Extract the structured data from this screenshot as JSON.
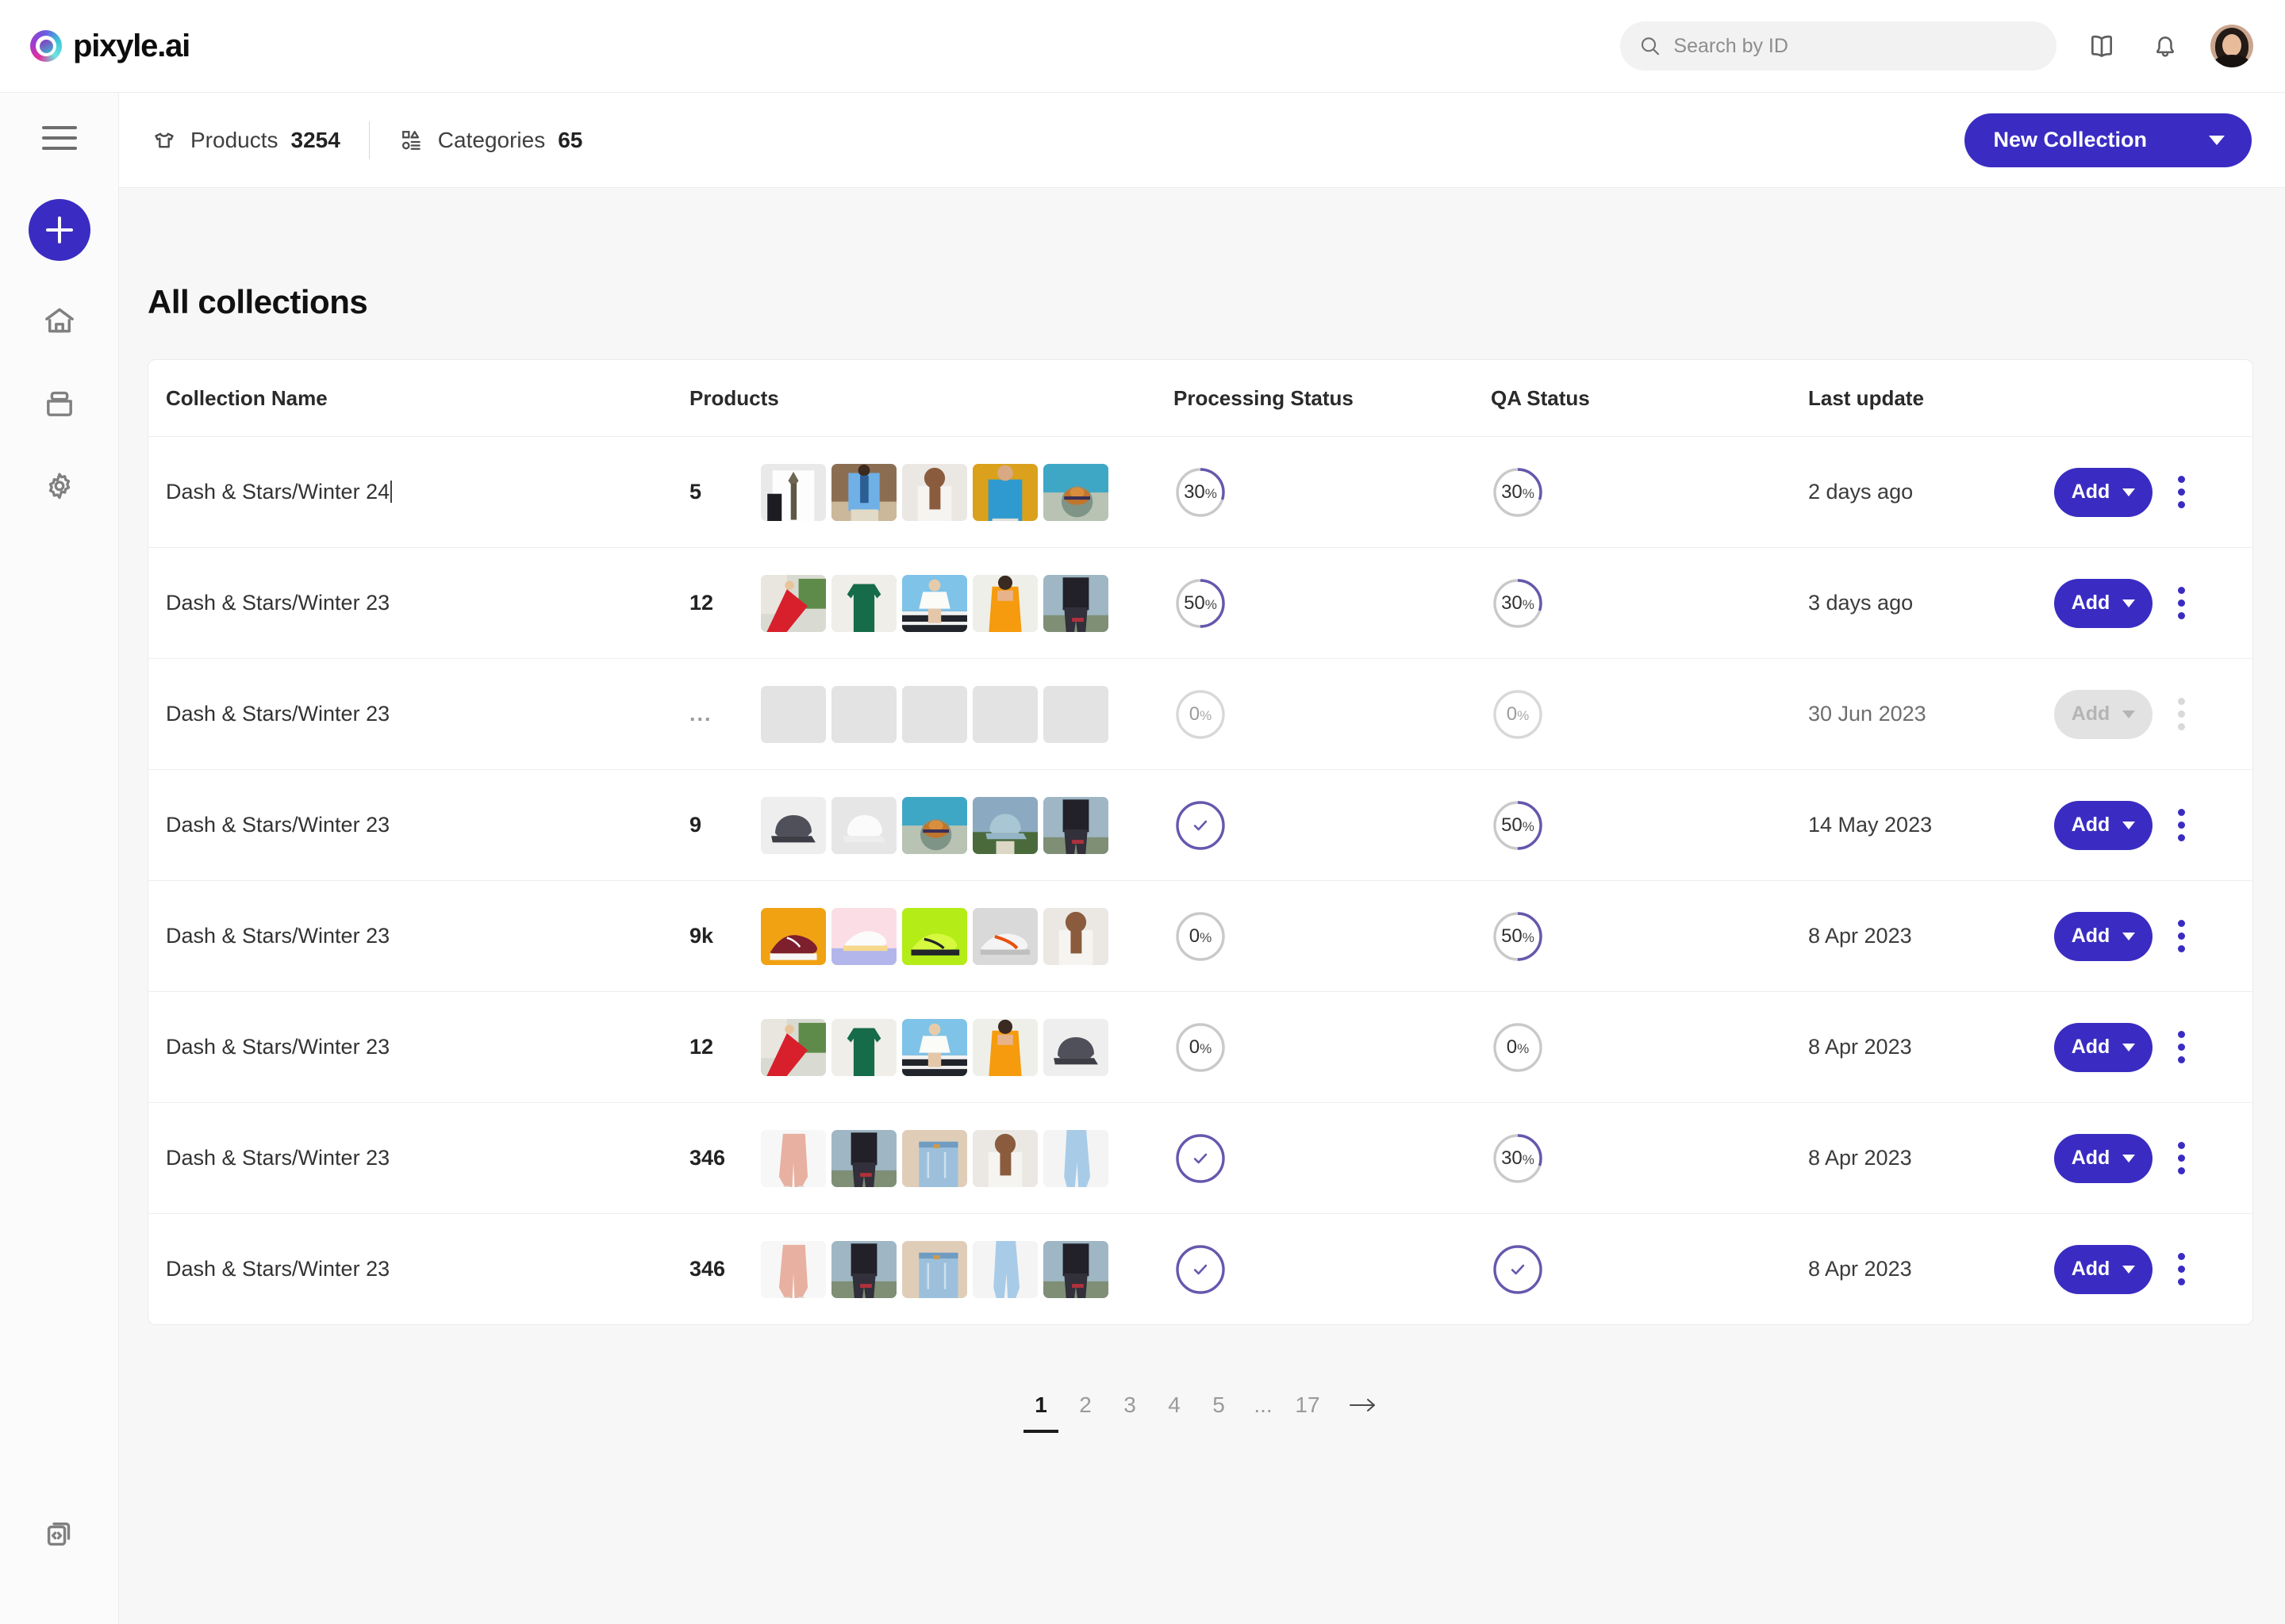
{
  "brand": {
    "name": "pixyle.ai",
    "logo_icon": "pixyle-eye-logo"
  },
  "search": {
    "placeholder": "Search by ID",
    "value": ""
  },
  "topbar_icons": [
    {
      "name": "book-icon"
    },
    {
      "name": "bell-icon"
    },
    {
      "name": "avatar"
    }
  ],
  "sidebar": {
    "menu_icon": "hamburger-icon",
    "add_icon": "plus-icon",
    "items": [
      {
        "name": "home-icon"
      },
      {
        "name": "archive-box-icon"
      },
      {
        "name": "gear-icon"
      }
    ],
    "bottom": {
      "name": "code-api-icon"
    }
  },
  "subbar": {
    "products_label": "Products",
    "products_count": "3254",
    "categories_label": "Categories",
    "categories_count": "65",
    "new_collection_label": "New Collection"
  },
  "main": {
    "page_title": "All collections",
    "columns": [
      "Collection Name",
      "Products",
      "",
      "Processing Status",
      "QA Status",
      "Last update",
      ""
    ],
    "rows": [
      {
        "name": "Dash & Stars/Winter 24",
        "editing": true,
        "count": "5",
        "processing": {
          "type": "percent",
          "value": "30",
          "pct": "%"
        },
        "qa": {
          "type": "percent",
          "value": "30",
          "pct": "%"
        },
        "updated": "2 days ago",
        "add_label": "Add",
        "disabled": false,
        "thumbs": [
          "shirt-tie-white",
          "blue-shirt-man",
          "white-shirt-man",
          "blue-denim-shirt",
          "straw-hat-water"
        ]
      },
      {
        "name": "Dash & Stars/Winter 23",
        "editing": false,
        "count": "12",
        "processing": {
          "type": "percent",
          "value": "50",
          "pct": "%"
        },
        "qa": {
          "type": "percent",
          "value": "30",
          "pct": "%"
        },
        "updated": "3 days ago",
        "add_label": "Add",
        "disabled": false,
        "thumbs": [
          "red-gown",
          "green-dress",
          "white-dress",
          "orange-dress",
          "dark-jeans"
        ]
      },
      {
        "name": "Dash & Stars/Winter 23",
        "editing": false,
        "count": "...",
        "processing": {
          "type": "percent",
          "value": "0",
          "pct": "%"
        },
        "qa": {
          "type": "percent",
          "value": "0",
          "pct": "%"
        },
        "updated": "30 Jun 2023",
        "add_label": "Add",
        "disabled": true,
        "thumbs": [
          "placeholder",
          "placeholder",
          "placeholder",
          "placeholder",
          "placeholder"
        ]
      },
      {
        "name": "Dash & Stars/Winter 23",
        "editing": false,
        "count": "9",
        "processing": {
          "type": "check"
        },
        "qa": {
          "type": "percent",
          "value": "50",
          "pct": "%"
        },
        "updated": "14 May 2023",
        "add_label": "Add",
        "disabled": false,
        "thumbs": [
          "grey-cap",
          "white-cap",
          "straw-hat-water",
          "blue-cap-man",
          "dark-jeans"
        ]
      },
      {
        "name": "Dash & Stars/Winter 23",
        "editing": false,
        "count": "9k",
        "processing": {
          "type": "percent",
          "value": "0",
          "pct": "%"
        },
        "qa": {
          "type": "percent",
          "value": "50",
          "pct": "%"
        },
        "updated": "8 Apr 2023",
        "add_label": "Add",
        "disabled": false,
        "thumbs": [
          "orange-sneaker",
          "pastel-sneaker",
          "green-sneaker",
          "red-runner",
          "white-shirt-man"
        ]
      },
      {
        "name": "Dash & Stars/Winter 23",
        "editing": false,
        "count": "12",
        "processing": {
          "type": "percent",
          "value": "0",
          "pct": "%"
        },
        "qa": {
          "type": "percent",
          "value": "0",
          "pct": "%"
        },
        "updated": "8 Apr 2023",
        "add_label": "Add",
        "disabled": false,
        "thumbs": [
          "red-gown",
          "green-dress",
          "white-dress",
          "orange-dress",
          "grey-cap"
        ]
      },
      {
        "name": "Dash & Stars/Winter 23",
        "editing": false,
        "count": "346",
        "processing": {
          "type": "check"
        },
        "qa": {
          "type": "percent",
          "value": "30",
          "pct": "%"
        },
        "updated": "8 Apr 2023",
        "add_label": "Add",
        "disabled": false,
        "thumbs": [
          "pink-joggers",
          "dark-jeans",
          "light-denim",
          "white-shirt-man",
          "light-blue-jeans"
        ]
      },
      {
        "name": "Dash & Stars/Winter 23",
        "editing": false,
        "count": "346",
        "processing": {
          "type": "check"
        },
        "qa": {
          "type": "check"
        },
        "updated": "8 Apr 2023",
        "add_label": "Add",
        "disabled": false,
        "thumbs": [
          "pink-joggers",
          "dark-jeans",
          "light-denim",
          "light-blue-jeans",
          "dark-jeans"
        ]
      }
    ],
    "pagination": {
      "pages": [
        "1",
        "2",
        "3",
        "4",
        "5",
        "...",
        "17"
      ],
      "active": "1",
      "next_icon": "arrow-right-icon"
    }
  },
  "colors": {
    "accent": "#3a2cc2",
    "ring_track": "#c9c9c9",
    "ring_fill": "#6458ad",
    "page_bg": "#f7f7f7"
  }
}
